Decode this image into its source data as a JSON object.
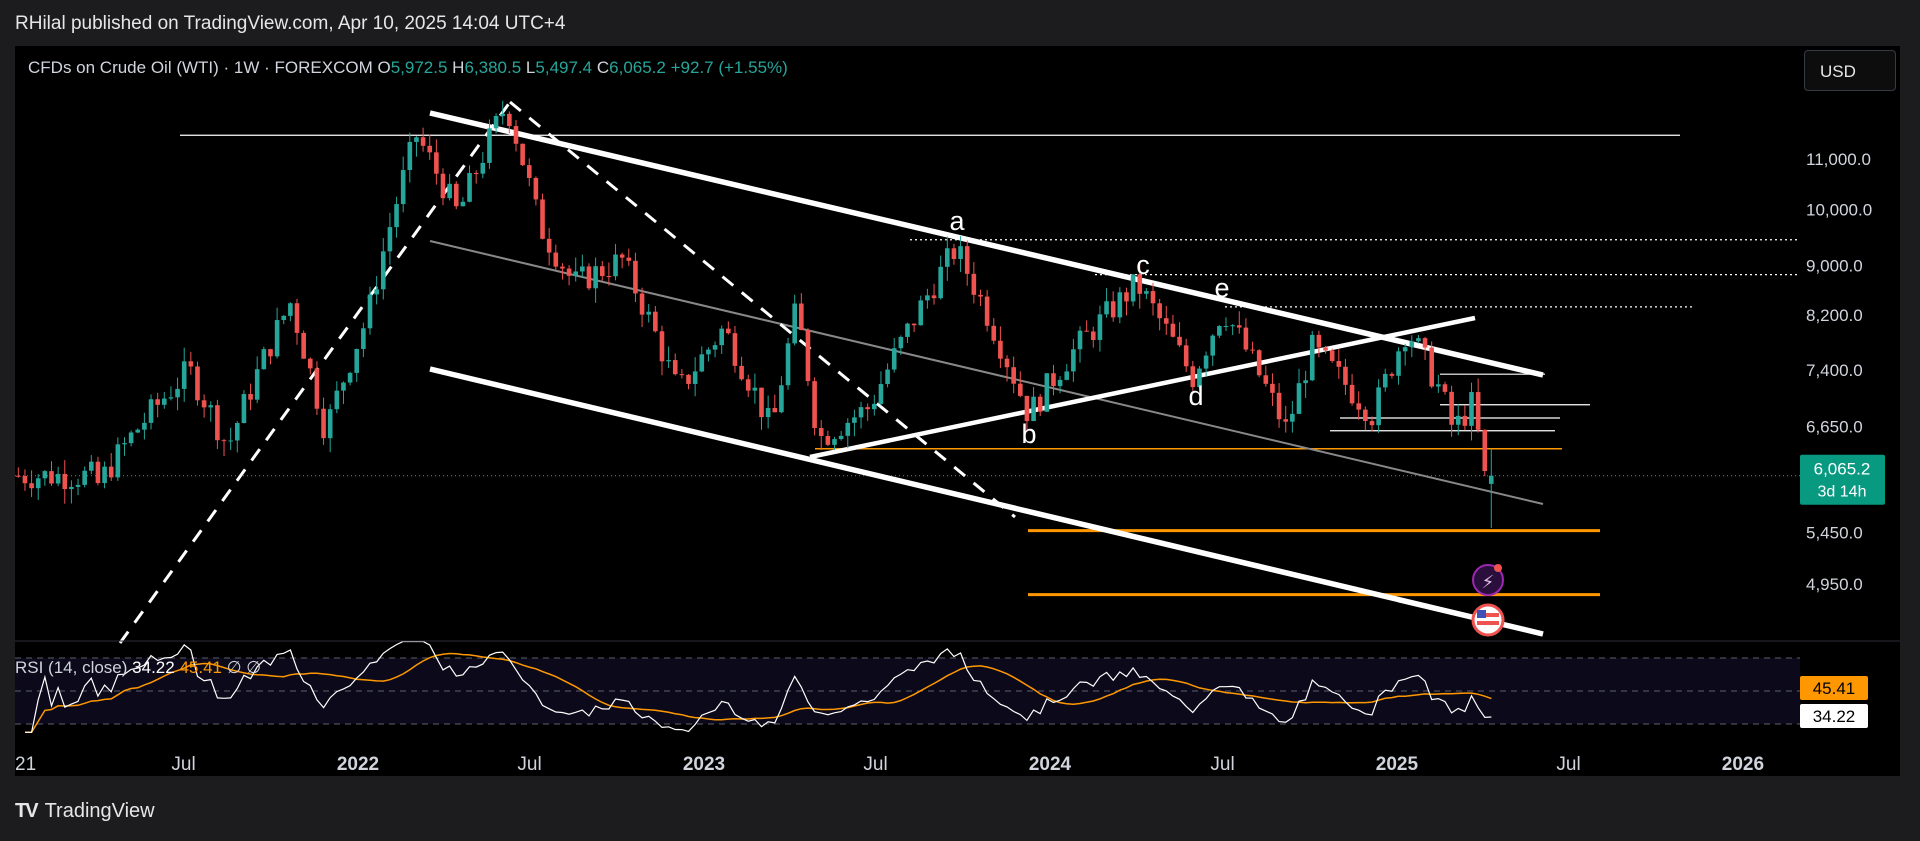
{
  "header": {
    "publisher": "RHilal published on TradingView.com, Apr 10, 2025 14:04 UTC+4"
  },
  "legend": {
    "symbol": "CFDs on Crude Oil (WTI) · 1W · FOREXCOM",
    "o_label": "O",
    "o": "5,972.5",
    "h_label": "H",
    "h": "6,380.5",
    "l_label": "L",
    "l": "5,497.4",
    "c_label": "C",
    "c": "6,065.2",
    "change": "+92.7 (+1.55%)"
  },
  "currency_button": "USD",
  "last_price": {
    "value": "6,065.2",
    "countdown": "3d 14h"
  },
  "rsi": {
    "label": "RSI (14, close)",
    "rsi_value": "34.22",
    "ma_value": "45.41",
    "extra1": "∅",
    "extra2": "∅",
    "badge_ma": "45.41",
    "badge_rsi": "34.22"
  },
  "footer": {
    "brand": "TradingView"
  },
  "colors": {
    "up": "#26a69a",
    "down": "#ef5350",
    "orange": "#ff9800",
    "rsi": "#ffffff",
    "background": "#000000"
  },
  "chart_data": {
    "type": "candlestick",
    "interval": "1W",
    "x_tick_labels": [
      "21",
      "Jul",
      "2022",
      "Jul",
      "2023",
      "Jul",
      "2024",
      "Jul",
      "2025",
      "Jul",
      "2026"
    ],
    "y_tick_labels": [
      "11,000.0",
      "10,000.0",
      "9,000.0",
      "8,200.0",
      "7,400.0",
      "6,650.0",
      "5,450.0",
      "4,950.0"
    ],
    "y_scale": "log",
    "wave_labels": [
      "a",
      "b",
      "c",
      "d",
      "e"
    ],
    "path": [
      [
        "2021-04-01",
        5900
      ],
      [
        "2021-05-15",
        6600
      ],
      [
        "2021-07-10",
        7400
      ],
      [
        "2021-08-20",
        6400
      ],
      [
        "2021-10-25",
        8400
      ],
      [
        "2021-12-01",
        6600
      ],
      [
        "2022-01-15",
        8200
      ],
      [
        "2022-03-07",
        11500
      ],
      [
        "2022-04-20",
        9900
      ],
      [
        "2022-06-10",
        12200
      ],
      [
        "2022-07-15",
        9700
      ],
      [
        "2022-08-20",
        8700
      ],
      [
        "2022-10-10",
        9100
      ],
      [
        "2022-12-08",
        7100
      ],
      [
        "2023-01-25",
        8000
      ],
      [
        "2023-03-17",
        6600
      ],
      [
        "2023-04-12",
        8300
      ],
      [
        "2023-05-05",
        6500
      ],
      [
        "2023-06-28",
        6900
      ],
      [
        "2023-09-27",
        9300
      ],
      [
        "2023-12-13",
        6800
      ],
      [
        "2024-01-25",
        7600
      ],
      [
        "2024-04-05",
        8700
      ],
      [
        "2024-06-03",
        7300
      ],
      [
        "2024-07-05",
        8300
      ],
      [
        "2024-09-10",
        6600
      ],
      [
        "2024-10-07",
        7700
      ],
      [
        "2024-12-10",
        6800
      ],
      [
        "2025-01-15",
        8000
      ],
      [
        "2025-02-20",
        7100
      ],
      [
        "2025-03-05",
        6600
      ],
      [
        "2025-03-28",
        7000
      ],
      [
        "2025-04-04",
        6000
      ],
      [
        "2025-04-10",
        6065
      ]
    ],
    "last_candle": {
      "open": 5972.5,
      "high": 6380.5,
      "low": 5497.4,
      "close": 6065.2
    },
    "rsi": {
      "period": 14,
      "source": "close",
      "value": 34.22,
      "ma_value": 45.41
    }
  }
}
